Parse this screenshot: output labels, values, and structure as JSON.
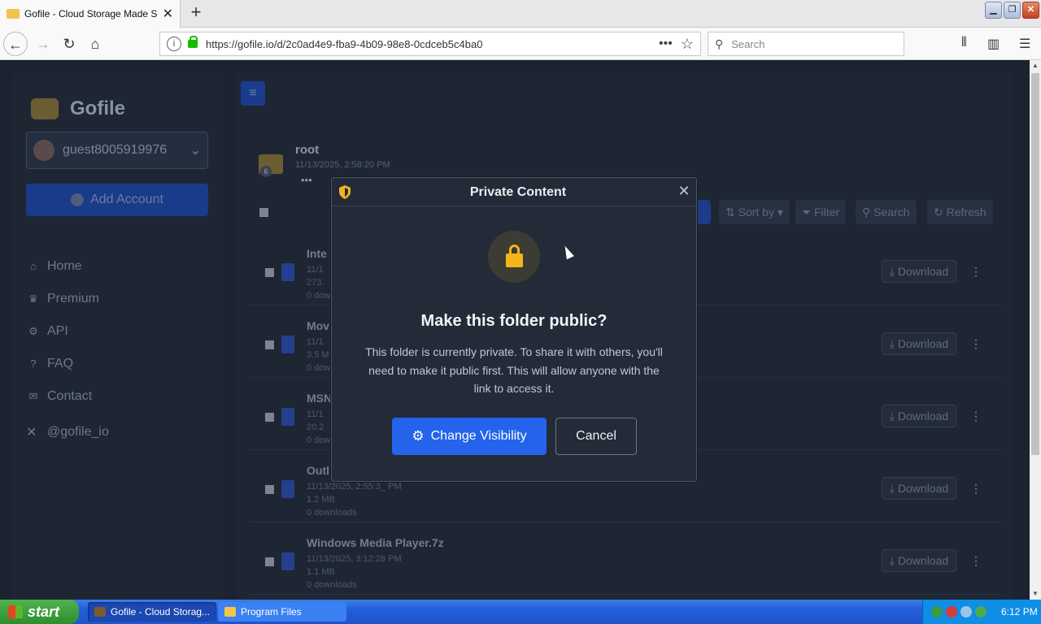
{
  "browser": {
    "tab_title": "Gofile - Cloud Storage Made Simple",
    "url": "https://gofile.io/d/2c0ad4e9-fba9-4b09-98e8-0cdceb5c4ba0",
    "search_placeholder": "Search"
  },
  "sidebar": {
    "brand": "Gofile",
    "username": "guest8005919976",
    "add_account": "Add Account",
    "menu": [
      {
        "label": "Home",
        "icon": "house-icon"
      },
      {
        "label": "Premium",
        "icon": "crown-icon"
      },
      {
        "label": "API",
        "icon": "gears-icon"
      },
      {
        "label": "FAQ",
        "icon": "question-icon"
      },
      {
        "label": "Contact",
        "icon": "envelope-icon"
      }
    ],
    "social": "@gofile_io"
  },
  "content": {
    "folder_name": "root",
    "folder_date": "11/13/2025, 2:58:20 PM",
    "folder_count": "6",
    "toolbar": {
      "sort": "Sort by",
      "filter": "Filter",
      "search": "Search",
      "refresh": "Refresh"
    },
    "download_label": "Download",
    "files": [
      {
        "name": "Inte",
        "date": "11/1",
        "size": "273.",
        "downloads": "0 dow"
      },
      {
        "name": "Mov",
        "date": "11/1",
        "size": "3.5 M",
        "downloads": "0 dow"
      },
      {
        "name": "MSN",
        "date": "11/1",
        "size": "20.2",
        "downloads": "0 dow"
      },
      {
        "name": "Outl",
        "date": "11/13/2025, 2:55:3_ PM",
        "size": "1.2 MB",
        "downloads": "0 downloads"
      },
      {
        "name": "Windows Media Player.7z",
        "date": "11/13/2025, 3:12:28 PM",
        "size": "1.1 MB",
        "downloads": "0 downloads"
      }
    ]
  },
  "modal": {
    "title": "Private Content",
    "heading": "Make this folder public?",
    "body": "This folder is currently private. To share it with others, you'll need to make it public first. This will allow anyone with the link to access it.",
    "primary_label": "Change Visibility",
    "cancel_label": "Cancel",
    "accent_color": "#2463eb",
    "lock_color": "#f2b51a"
  },
  "taskbar": {
    "start_label": "start",
    "tasks": [
      "Gofile - Cloud Storag...",
      "Program Files"
    ],
    "clock": "6:12 PM"
  }
}
